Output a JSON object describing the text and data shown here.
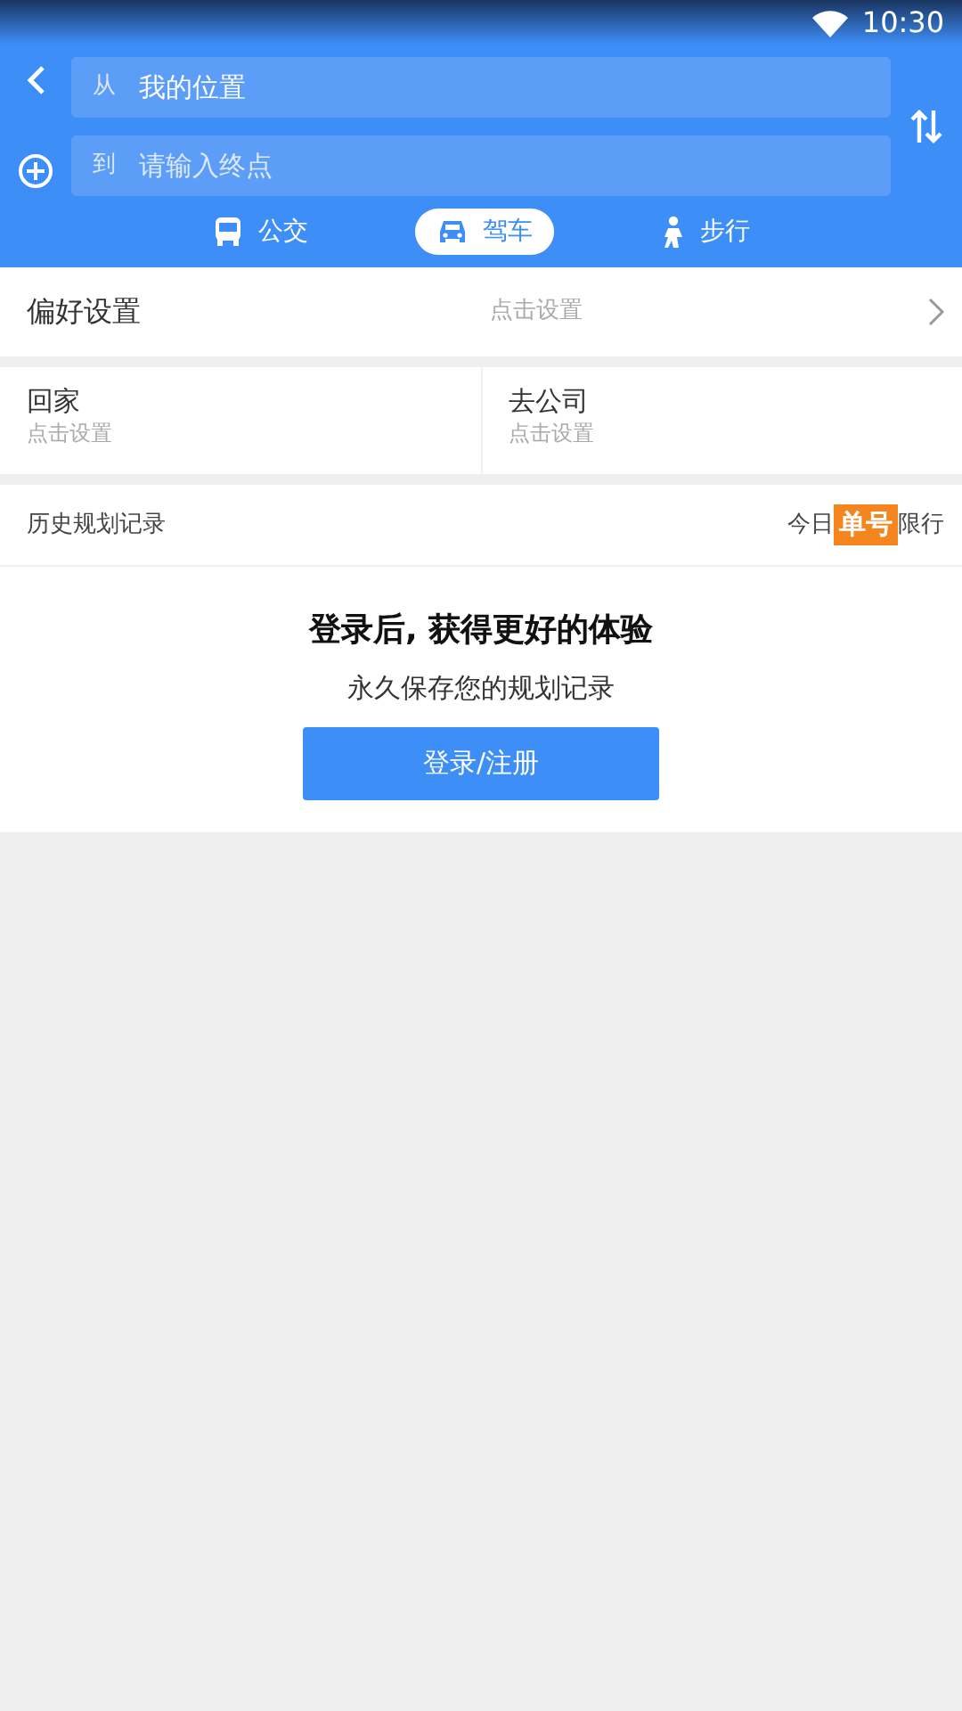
{
  "status_bar": {
    "time": "10:30"
  },
  "route": {
    "from": {
      "label": "从",
      "value": "我的位置"
    },
    "to": {
      "label": "到",
      "placeholder": "请输入终点"
    }
  },
  "modes": [
    {
      "label": "公交",
      "kind": "bus",
      "selected": false
    },
    {
      "label": "驾车",
      "kind": "car",
      "selected": true
    },
    {
      "label": "步行",
      "kind": "walk",
      "selected": false
    }
  ],
  "preference": {
    "title": "偏好设置",
    "hint": "点击设置"
  },
  "shortcuts": [
    {
      "title": "回家",
      "hint": "点击设置"
    },
    {
      "title": "去公司",
      "hint": "点击设置"
    }
  ],
  "history": {
    "title": "历史规划记录",
    "prefix": "今日",
    "badge": "单号",
    "suffix": "限行"
  },
  "login": {
    "title": "登录后, 获得更好的体验",
    "subtitle": "永久保存您的规划记录",
    "button": "登录/注册"
  }
}
